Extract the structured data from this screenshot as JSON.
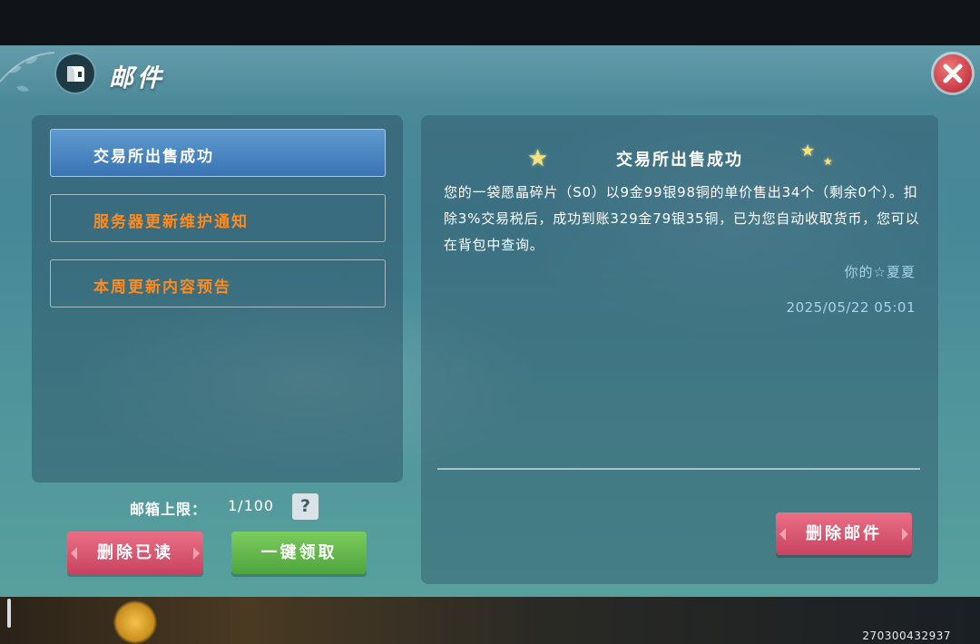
{
  "window": {
    "title": "邮件"
  },
  "mail_list": [
    {
      "label": "交易所出售成功",
      "state": "selected"
    },
    {
      "label": "服务器更新维护通知",
      "state": "unread"
    },
    {
      "label": "本周更新内容预告",
      "state": "unread"
    }
  ],
  "mailbox": {
    "capacity_label": "邮箱上限：",
    "capacity_value": "1/100",
    "help_label": "?"
  },
  "buttons": {
    "delete_read": "删除已读",
    "claim_all": "一键领取",
    "delete_mail": "删除邮件"
  },
  "mail_detail": {
    "title": "交易所出售成功",
    "body": "您的一袋愿晶碎片（S0）以9金99银98铜的单价售出34个（剩余0个）。扣除3%交易税后，成功到账329金79银35铜，已为您自动收取货币，您可以在背包中查询。",
    "sender": "你的☆夏夏",
    "date": "2025/05/22 05:01"
  },
  "footer": {
    "uid": "270300432937"
  },
  "colors": {
    "accent_unread": "#ff8a1e",
    "selected_item": "#4a86c2",
    "danger_button": "#d95571",
    "confirm_button": "#62b84c"
  },
  "icons": [
    "mail-icon",
    "close-icon",
    "help-icon",
    "star-icon"
  ]
}
